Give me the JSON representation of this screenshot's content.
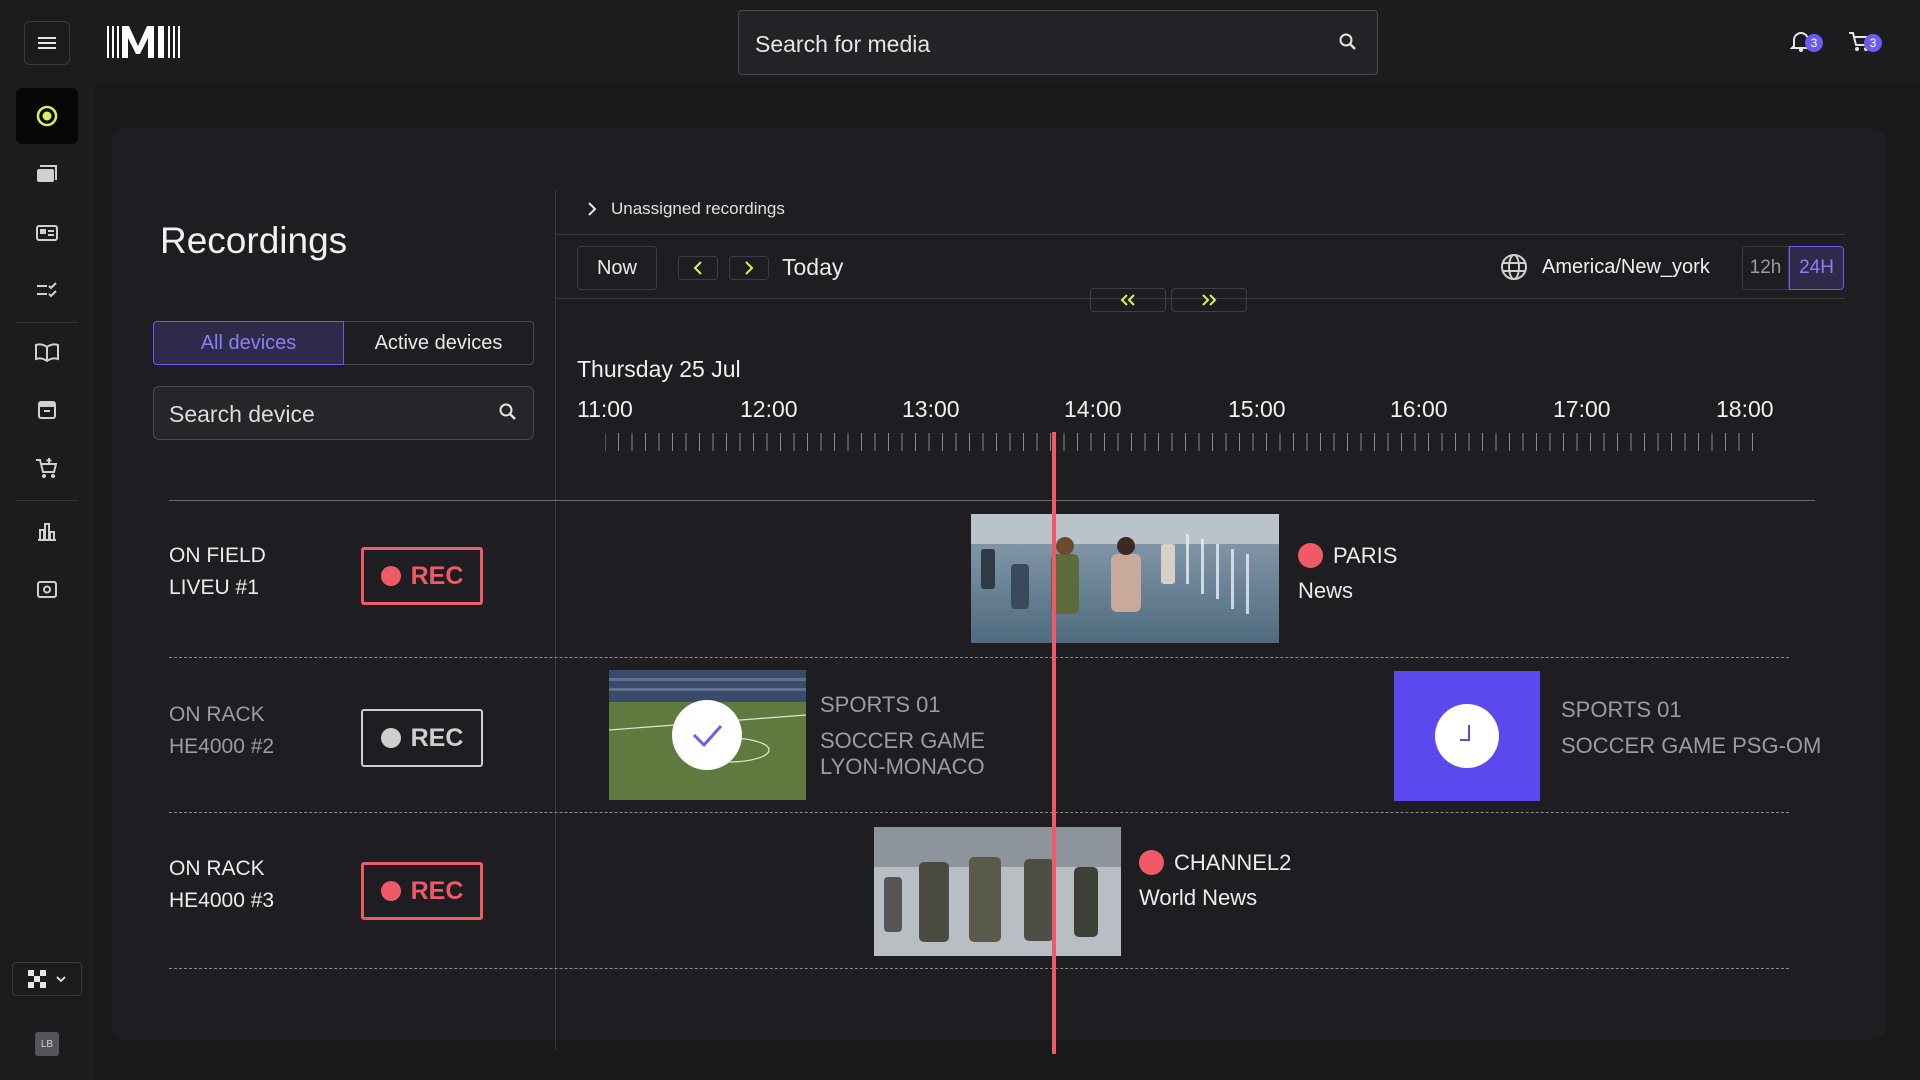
{
  "topbar": {
    "logo_text": "IMI",
    "search_placeholder": "Search for media",
    "notifications_count": "3",
    "cart_count": "3"
  },
  "sidebar": {
    "items": [
      "radio-target-icon",
      "folder-icon",
      "media-card-icon",
      "checklist-icon",
      "book-icon",
      "archive-icon",
      "cart-icon",
      "bar-chart-icon",
      "settings-box-icon"
    ],
    "workspace_icon": "checkered-icon",
    "user_initials": "LB"
  },
  "page": {
    "title": "Recordings",
    "filter_all": "All devices",
    "filter_active": "Active devices",
    "device_search_placeholder": "Search device"
  },
  "timeline": {
    "unassigned_label": "Unassigned recordings",
    "now_label": "Now",
    "today_label": "Today",
    "timezone": "America/New_york",
    "mode_12h": "12h",
    "mode_24h": "24H",
    "date_label": "Thursday 25 Jul",
    "hours": [
      "11:00",
      "12:00",
      "13:00",
      "14:00",
      "15:00",
      "16:00",
      "17:00",
      "18:00"
    ],
    "current_time_fraction": 0.279
  },
  "devices": [
    {
      "line1": "ON FIELD",
      "line2": "LIVEU #1",
      "rec_label": "REC",
      "state": "recording"
    },
    {
      "line1": "ON RACK",
      "line2": "HE4000 #2",
      "rec_label": "REC",
      "state": "idle"
    },
    {
      "line1": "ON RACK",
      "line2": "HE4000 #3",
      "rec_label": "REC",
      "state": "recording"
    }
  ],
  "events": {
    "paris": {
      "channel": "PARIS",
      "program": "News"
    },
    "sports_done": {
      "channel": "SPORTS 01",
      "program_line1": "SOCCER GAME",
      "program_line2": "LYON-MONACO"
    },
    "sports_scheduled": {
      "channel": "SPORTS 01",
      "program": "SOCCER GAME PSG-OM"
    },
    "channel2": {
      "channel": "CHANNEL2",
      "program": "World News"
    }
  },
  "colors": {
    "accent": "#6b5cf0",
    "record_red": "#f05a67",
    "active_nav": "#d9f05a"
  }
}
